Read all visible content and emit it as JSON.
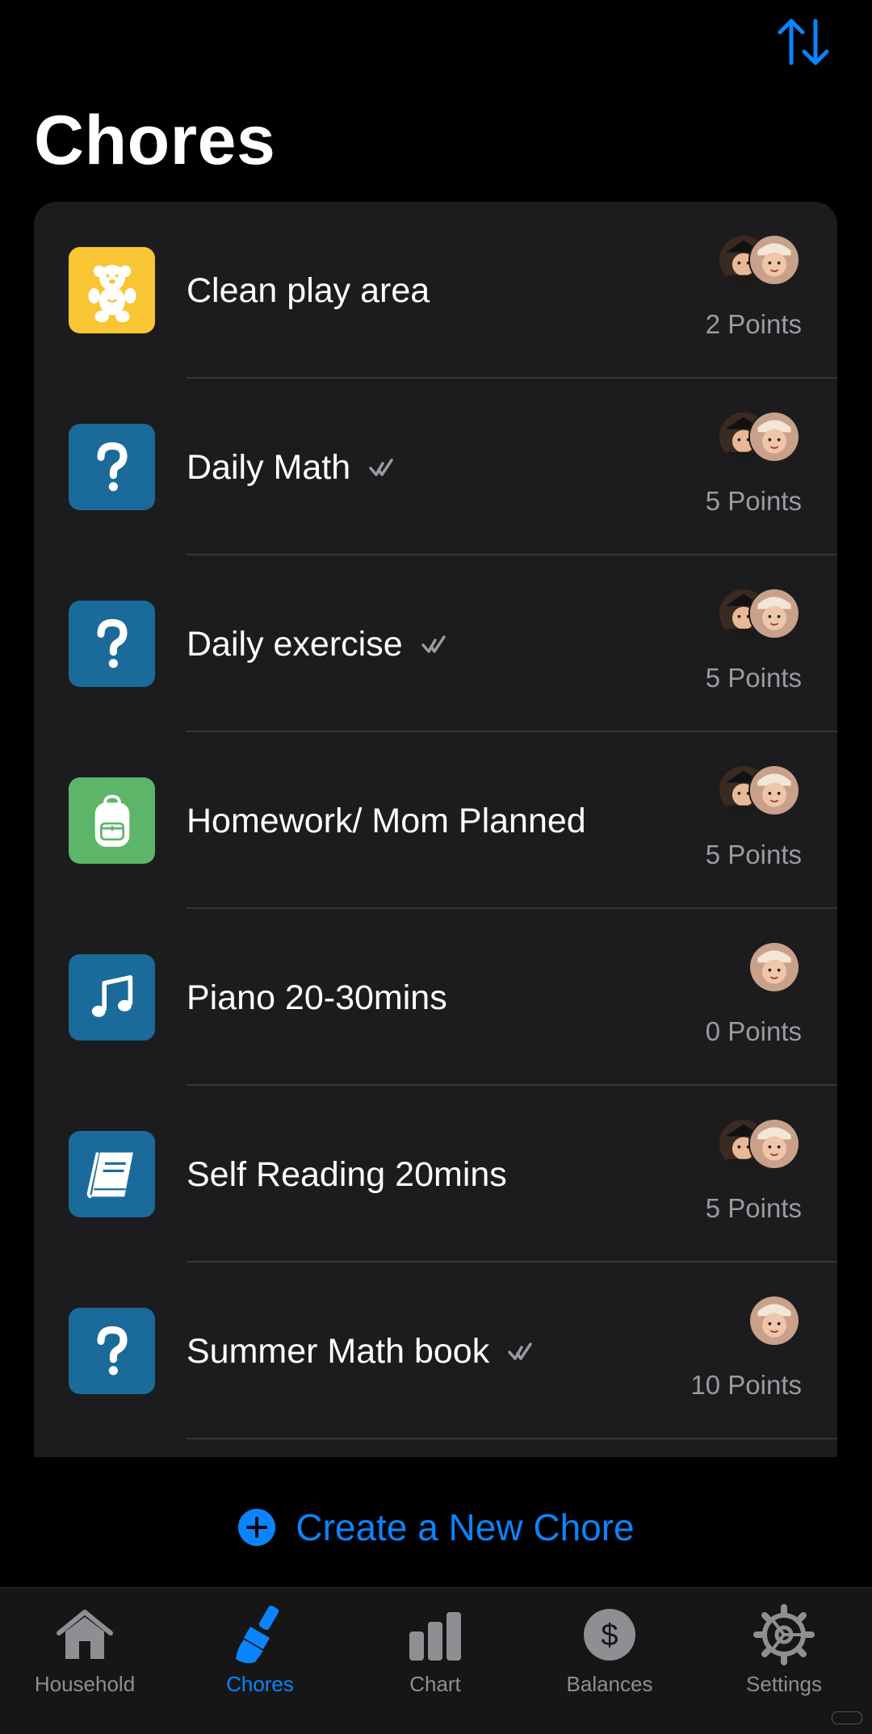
{
  "header": {
    "title": "Chores",
    "sort_icon": "sort-arrows-icon"
  },
  "colors": {
    "accent": "#0a84ff",
    "yellow": "#f8c534",
    "blue": "#1a6b9a",
    "green": "#5db56a",
    "background": "#000000",
    "card": "#1c1c1e"
  },
  "chores": [
    {
      "label": "Clean play area",
      "points": "2 Points",
      "icon": "teddy-bear-icon",
      "verified": false,
      "avatars": [
        "avatar-pirate-child",
        "avatar-child"
      ]
    },
    {
      "label": "Daily Math",
      "points": "5 Points",
      "icon": "question-mark-icon",
      "verified": true,
      "avatars": [
        "avatar-pirate-child",
        "avatar-child"
      ]
    },
    {
      "label": "Daily exercise",
      "points": "5 Points",
      "icon": "question-mark-icon",
      "verified": true,
      "avatars": [
        "avatar-pirate-child",
        "avatar-child"
      ]
    },
    {
      "label": "Homework/ Mom Planned",
      "points": "5 Points",
      "icon": "backpack-icon",
      "verified": false,
      "avatars": [
        "avatar-pirate-child",
        "avatar-child"
      ]
    },
    {
      "label": "Piano 20-30mins",
      "points": "0 Points",
      "icon": "music-note-icon",
      "verified": false,
      "avatars": [
        "avatar-child"
      ]
    },
    {
      "label": "Self Reading 20mins",
      "points": "5 Points",
      "icon": "book-icon",
      "verified": false,
      "avatars": [
        "avatar-pirate-child",
        "avatar-child"
      ]
    },
    {
      "label": "Summer Math book",
      "points": "10 Points",
      "icon": "question-mark-icon",
      "verified": true,
      "avatars": [
        "avatar-child"
      ]
    }
  ],
  "actions": {
    "create_label": "Create a New Chore"
  },
  "tabs": [
    {
      "label": "Household",
      "icon": "house-icon",
      "active": false
    },
    {
      "label": "Chores",
      "icon": "brush-icon",
      "active": true
    },
    {
      "label": "Chart",
      "icon": "bar-chart-icon",
      "active": false
    },
    {
      "label": "Balances",
      "icon": "dollar-circle-icon",
      "active": false
    },
    {
      "label": "Settings",
      "icon": "gear-icon",
      "active": false
    }
  ]
}
